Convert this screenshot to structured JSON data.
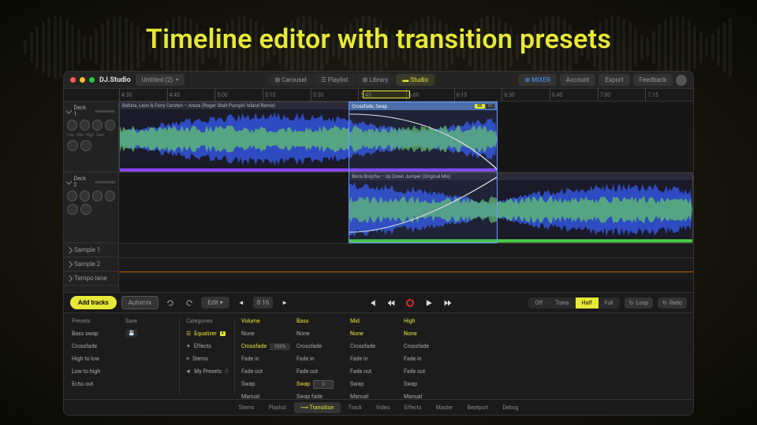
{
  "headline": "Timeline editor with transition presets",
  "titlebar": {
    "app": "DJ.Studio",
    "project": "Untitled (2)",
    "tabs": [
      "⊞ Carousel",
      "☰ Playlist",
      "⊞ Library",
      "▬ Studio"
    ],
    "mixer": "⊕ MIXER",
    "account": "Account",
    "export": "Export",
    "feedback": "Feedback"
  },
  "ruler": [
    "4:30",
    "4:45",
    "5:00",
    "5:15",
    "5:30",
    "5:45",
    "6:00",
    "6:15",
    "6:30",
    "6:45",
    "7:00",
    "7:15"
  ],
  "tracks": [
    {
      "name": "Deck 1"
    },
    {
      "name": "Deck 2"
    },
    {
      "name": "Sample 1"
    },
    {
      "name": "Sample 2"
    },
    {
      "name": "Tempo lane"
    }
  ],
  "knobLabels": [
    "Low",
    "Mid",
    "High",
    "Gain"
  ],
  "clips": [
    {
      "title": "Bobina, Leon & Ferry Corsten – Anura (Roger Shah Pumpin' Island Remix)"
    },
    {
      "title": "Boris Brejcha – Up Down Jumper (Original Mix)"
    }
  ],
  "transition": {
    "label": "Crossfade, Swap",
    "modes": [
      "BB",
      "SS"
    ]
  },
  "transport": {
    "addTracks": "Add tracks",
    "automix": "Automix",
    "edit": "Edit",
    "snapBars": "8   16",
    "zoom": [
      "Off",
      "Trans",
      "Half",
      "Full"
    ],
    "loop": "Loop",
    "redo": "Redo"
  },
  "presets": {
    "head": "Presets",
    "saveHead": "Save",
    "items": [
      "Bass swap",
      "Crossfade",
      "High to low",
      "Low to high",
      "Echo out"
    ]
  },
  "categories": {
    "head": "Categories",
    "items": [
      "Equalizer",
      "Effects",
      "Stems",
      "My Presets"
    ],
    "badge": "4",
    "count": "0"
  },
  "eqOptions": [
    "None",
    "Crossfade",
    "Fade in",
    "Fade out",
    "Swap",
    "Manual"
  ],
  "eqcols": [
    {
      "head": "Volume",
      "val": "100%"
    },
    {
      "head": "Bass",
      "val": "0",
      "extra": "Swap fade"
    },
    {
      "head": "Mid"
    },
    {
      "head": "High"
    }
  ],
  "bottomTabs": [
    "Stems",
    "Playlist",
    "⟿ Transition",
    "Track",
    "Video",
    "Effects",
    "Master",
    "Beatport",
    "Debug"
  ]
}
